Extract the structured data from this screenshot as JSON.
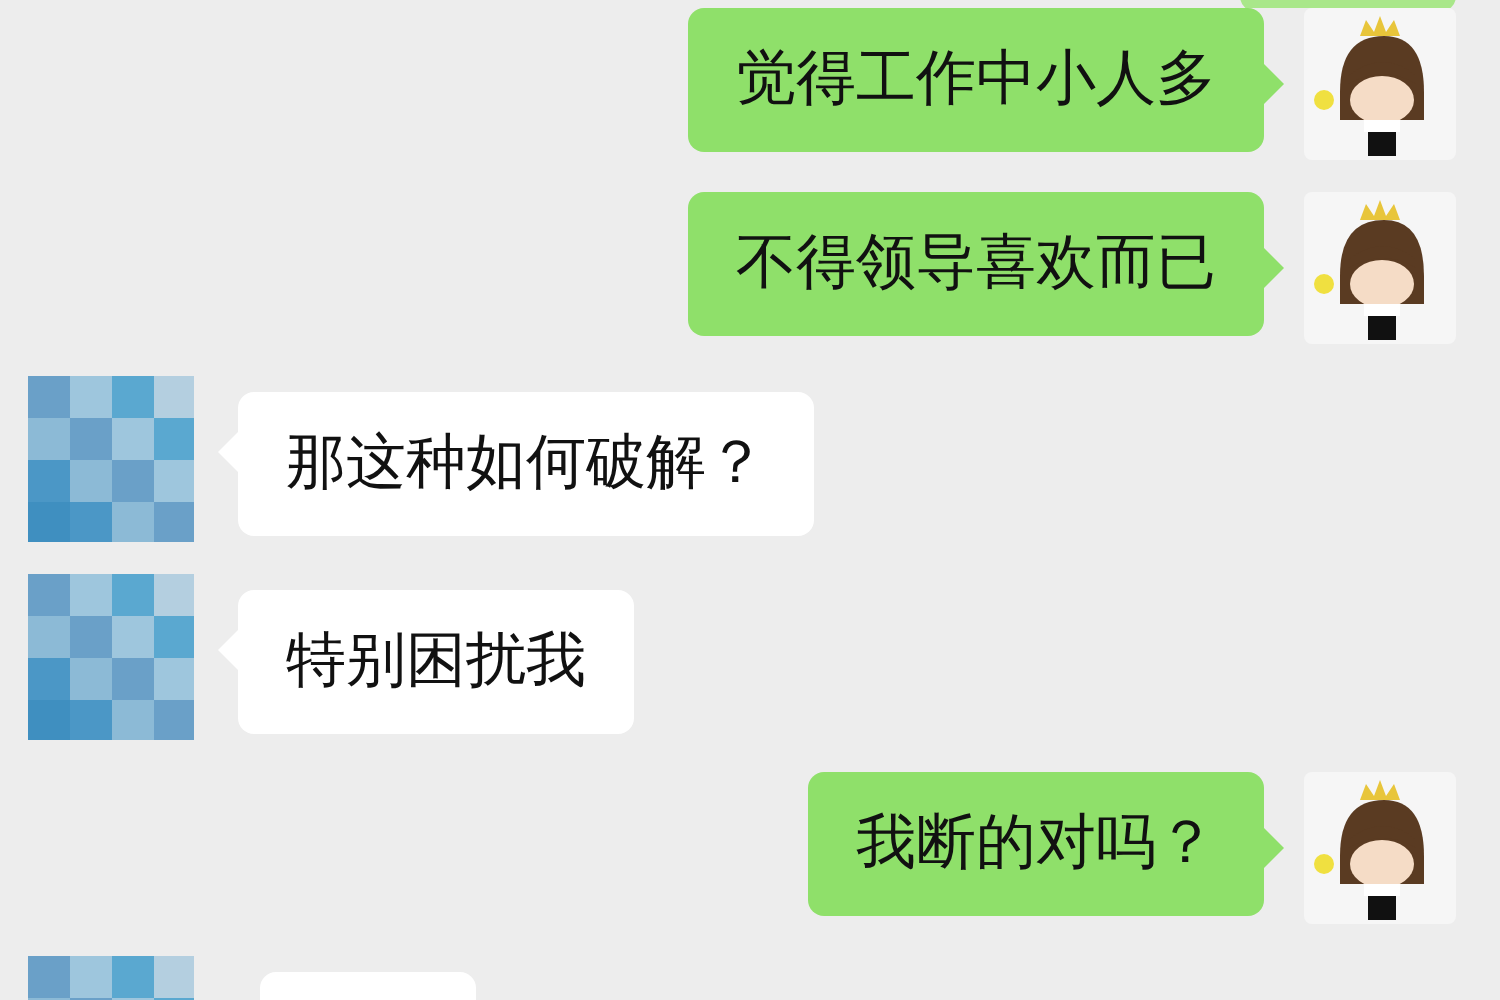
{
  "messages": [
    {
      "kind": "sent",
      "cut": true
    },
    {
      "kind": "sent",
      "cut": false,
      "text": "觉得工作中小人多"
    },
    {
      "kind": "sent",
      "cut": false,
      "text": "不得领导喜欢而已"
    },
    {
      "kind": "received",
      "cut": false,
      "text": "那这种如何破解？"
    },
    {
      "kind": "received",
      "cut": false,
      "text": "特别困扰我"
    },
    {
      "kind": "sent",
      "cut": false,
      "text": "我断的对吗？"
    },
    {
      "kind": "received",
      "cut": true
    }
  ]
}
